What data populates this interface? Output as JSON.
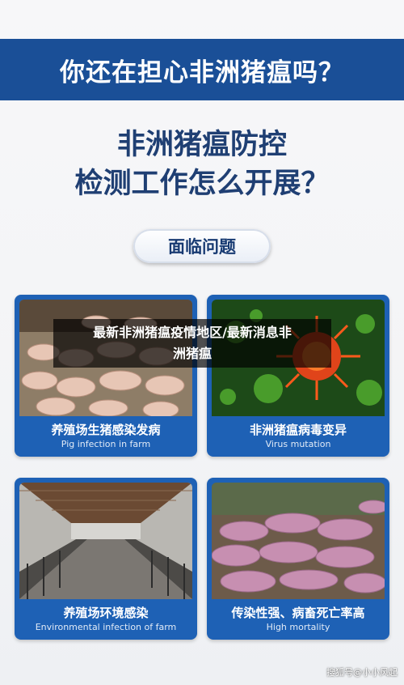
{
  "banner": {
    "title": "你还在担心非洲猪瘟吗？"
  },
  "headline": {
    "line1": "非洲猪瘟防控",
    "line2": "检测工作怎么开展？"
  },
  "pill": {
    "label": "面临问题"
  },
  "cards": [
    {
      "cn": "养殖场生猪感染发病",
      "en": "Pig infection in farm",
      "image": "pigs-in-pen-photo"
    },
    {
      "cn": "非洲猪瘟病毒变异",
      "en": "Virus mutation",
      "image": "virus-illustration"
    },
    {
      "cn": "养殖场环境感染",
      "en": "Environmental infection of farm",
      "image": "farm-barn-photo"
    },
    {
      "cn": "传染性强、病畜死亡率高",
      "en": "High mortality",
      "image": "dead-pigs-photo"
    }
  ],
  "overlay": {
    "line1": "最新非洲猪瘟疫情地区/最新消息非",
    "line2": "洲猪瘟"
  },
  "watermark": {
    "text": "搜狐号@小小风起"
  },
  "colors": {
    "brand_blue": "#1a4f97",
    "card_blue": "#1e61b5",
    "headline_navy": "#1f3f73"
  }
}
